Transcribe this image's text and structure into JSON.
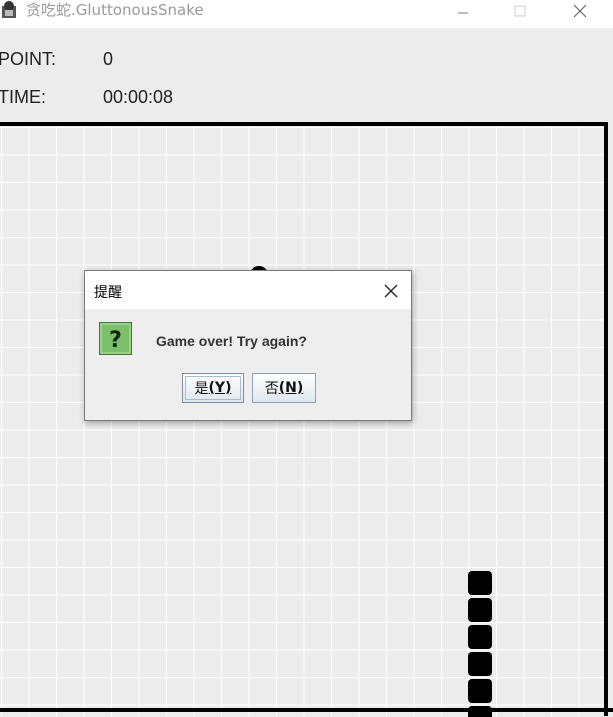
{
  "window": {
    "title": "贪吃蛇.GluttonousSnake",
    "controls": [
      "minimize-icon",
      "maximize-icon",
      "close-icon"
    ]
  },
  "info": {
    "point_label": "POINT:",
    "point_value": "0",
    "time_label": "TIME:",
    "time_value": "00:00:08"
  },
  "dialog": {
    "title": "提醒",
    "icon": "question-icon",
    "message": "Game over! Try again?",
    "yes_text": "是",
    "yes_mnemonic": "(Y)",
    "no_text": "否",
    "no_mnemonic": "(N)"
  },
  "colors": {
    "board_background": "#ececec",
    "grid_line": "#ffffff",
    "snake": "#000000",
    "icon_green": "#7bbf6a"
  }
}
